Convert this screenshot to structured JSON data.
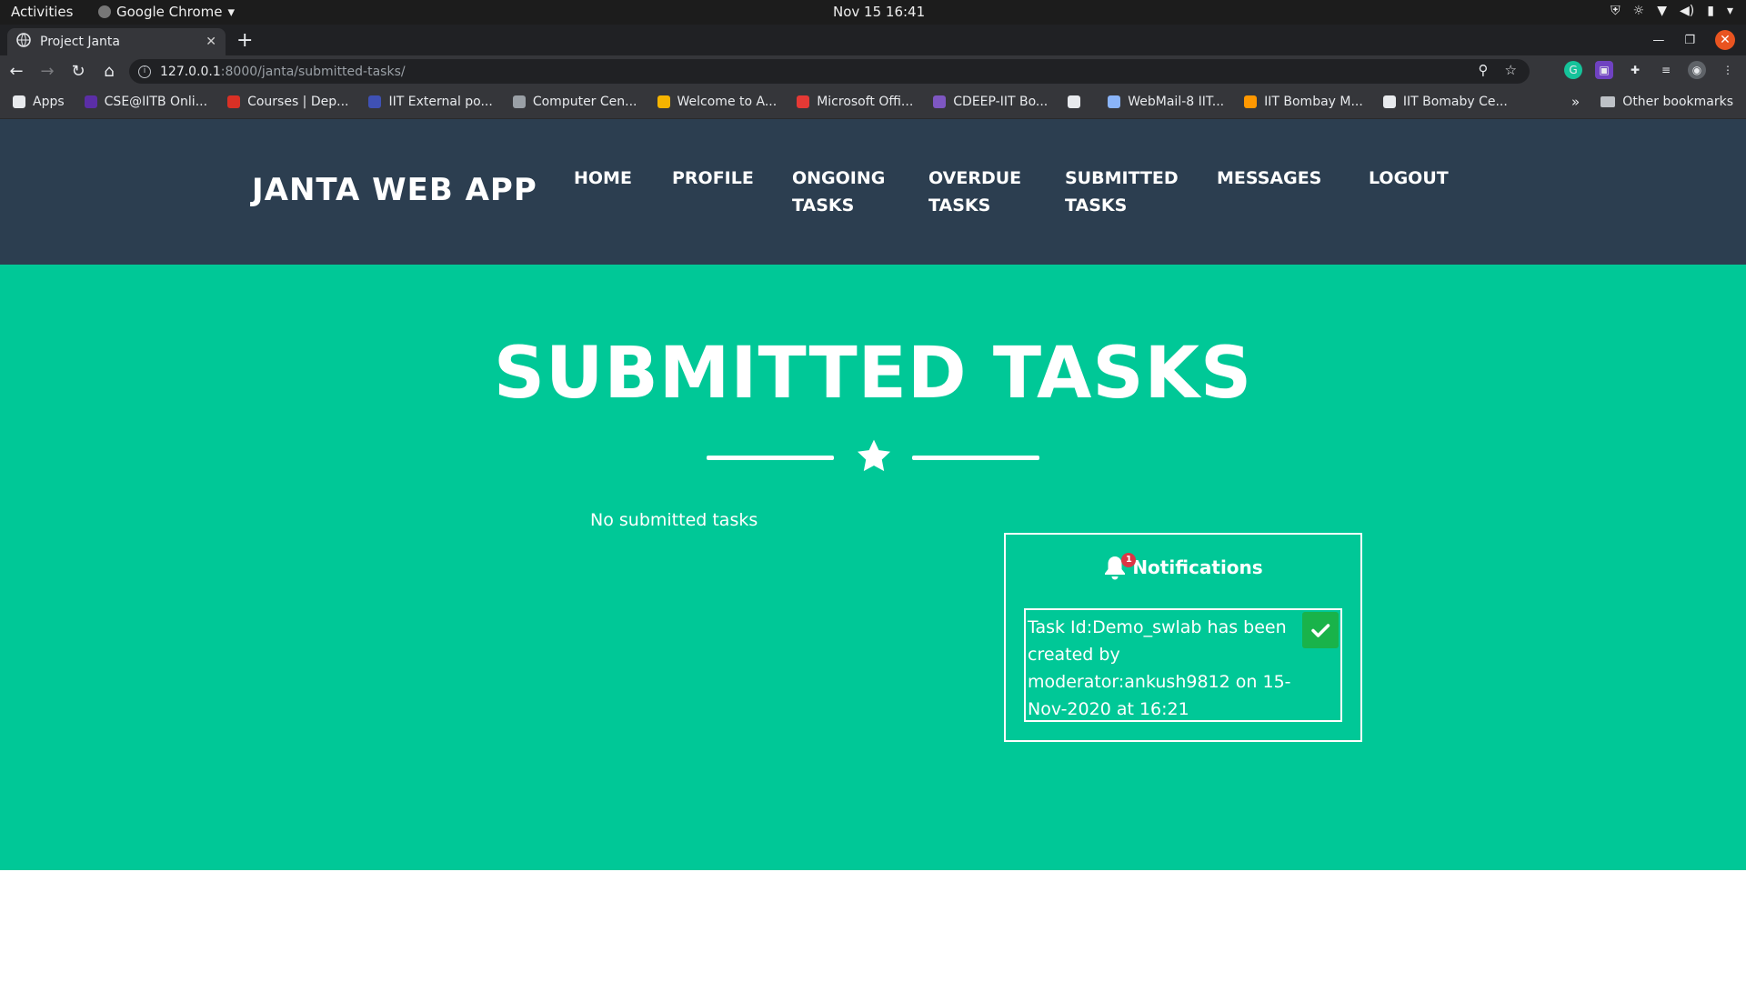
{
  "os": {
    "activities": "Activities",
    "app_name": "Google Chrome",
    "clock": "Nov 15  16:41"
  },
  "browser": {
    "tab_title": "Project Janta",
    "url_host": "127.0.0.1",
    "url_path": ":8000/janta/submitted-tasks/",
    "bookmarks": [
      {
        "label": "Apps",
        "color": "#e8eaed"
      },
      {
        "label": "CSE@IITB Onli...",
        "color": "#5b2ea6"
      },
      {
        "label": "Courses | Dep...",
        "color": "#d93025"
      },
      {
        "label": "IIT External po...",
        "color": "#3f51b5"
      },
      {
        "label": "Computer Cen...",
        "color": "#9aa0a6"
      },
      {
        "label": "Welcome to A...",
        "color": "#f6b400"
      },
      {
        "label": "Microsoft Offi...",
        "color": "#e53935"
      },
      {
        "label": "CDEEP-IIT Bo...",
        "color": "#7e57c2"
      },
      {
        "label": "",
        "color": "#e8eaed"
      },
      {
        "label": "WebMail-8 IIT...",
        "color": "#8ab4f8"
      },
      {
        "label": "IIT Bombay M...",
        "color": "#ff9800"
      },
      {
        "label": "IIT Bomaby Ce...",
        "color": "#e8eaed"
      }
    ],
    "bookmarks_overflow": "»",
    "other_bookmarks": "Other bookmarks"
  },
  "site": {
    "brand": "JANTA WEB APP",
    "nav": [
      {
        "label": "HOME",
        "key": "home"
      },
      {
        "label": "PROFILE",
        "key": "profile"
      },
      {
        "label": "ONGOING\nTASKS",
        "key": "ongoing"
      },
      {
        "label": "OVERDUE\nTASKS",
        "key": "overdue"
      },
      {
        "label": "SUBMITTED\nTASKS",
        "key": "submitted"
      },
      {
        "label": "MESSAGES",
        "key": "messages"
      },
      {
        "label": "LOGOUT",
        "key": "logout"
      }
    ],
    "nav_color": "#2c3e50",
    "accent_color": "#00c897"
  },
  "main": {
    "title": "SUBMITTED TASKS",
    "empty_message": "No submitted tasks",
    "notifications": {
      "heading": "Notifications",
      "badge_count": "1",
      "items": [
        {
          "text": "Task Id:Demo_swlab has been created by moderator:ankush9812 on 15-Nov-2020 at 16:21"
        }
      ]
    }
  }
}
